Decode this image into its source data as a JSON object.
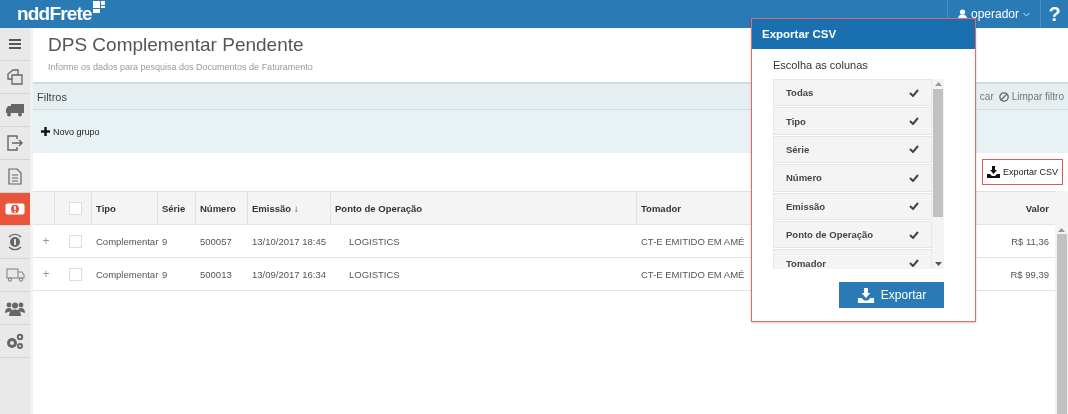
{
  "topbar": {
    "logo": "nddFrete",
    "user": "operador",
    "help": "?"
  },
  "sidebar": {
    "items": [
      {
        "selected": false
      },
      {
        "selected": false
      },
      {
        "selected": false
      },
      {
        "selected": false
      },
      {
        "selected": false
      },
      {
        "selected": true
      },
      {
        "selected": false
      },
      {
        "selected": false
      },
      {
        "selected": false
      },
      {
        "selected": false
      }
    ]
  },
  "page": {
    "title": "DPS Complementar Pendente",
    "subtitle": "Informe os dados para pesquisa dos Documentos de Faturamento"
  },
  "filters": {
    "label": "Filtros",
    "search_partial": "car",
    "clear": "Limpar filtro",
    "new_group": "Novo grupo"
  },
  "export_button": "Exportar CSV",
  "table": {
    "all_checked": false,
    "columns": [
      "Tipo",
      "Série",
      "Número",
      "Emissão ↓",
      "Ponto de Operação",
      "Tomador",
      "Valor"
    ],
    "rows": [
      {
        "expand": "+",
        "checked": false,
        "cells": [
          "Complementar",
          "9",
          "500057",
          "13/10/2017 18:45",
          "LOGISTICS",
          "CT-E EMITIDO EM AMÉ",
          "R$ 11,36"
        ]
      },
      {
        "expand": "+",
        "checked": false,
        "cells": [
          "Complementar",
          "9",
          "500013",
          "13/09/2017 16:34",
          "LOGISTICS",
          "CT-E EMITIDO EM AMÉ",
          "R$ 99,39"
        ]
      }
    ]
  },
  "export_dialog": {
    "title": "Exportar CSV",
    "prompt": "Escolha as colunas",
    "columns": [
      {
        "label": "Todas",
        "checked": true
      },
      {
        "label": "Tipo",
        "checked": true
      },
      {
        "label": "Série",
        "checked": true
      },
      {
        "label": "Número",
        "checked": true
      },
      {
        "label": "Emissão",
        "checked": true
      },
      {
        "label": "Ponto de Operação",
        "checked": true
      },
      {
        "label": "Tomador",
        "checked": true
      }
    ],
    "button": "Exportar"
  }
}
